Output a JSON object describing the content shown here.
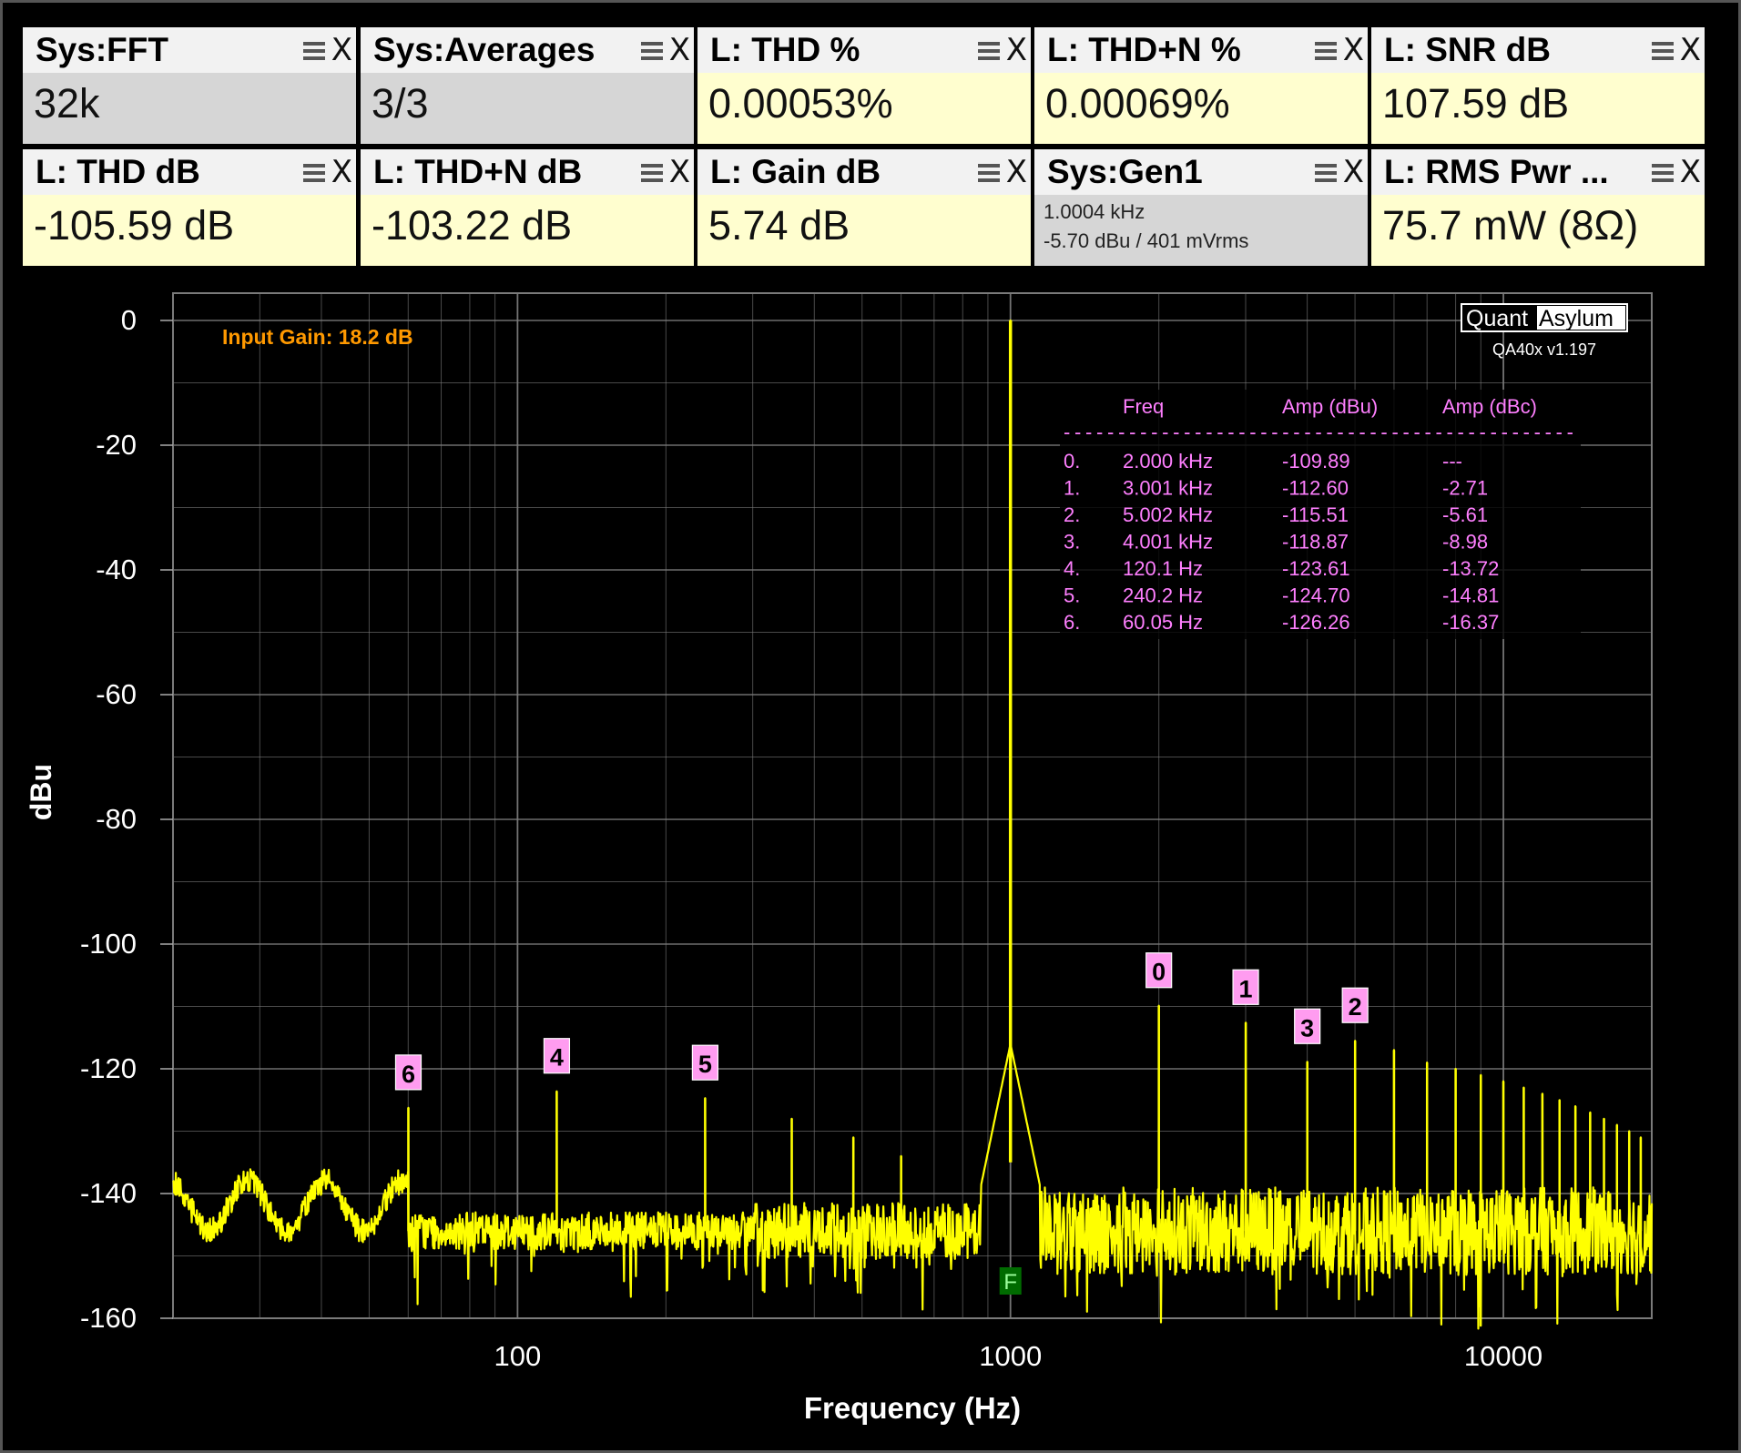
{
  "widgets": [
    {
      "title": "Sys:FFT",
      "value": "32k",
      "bg": "gray"
    },
    {
      "title": "Sys:Averages",
      "value": "3/3",
      "bg": "gray"
    },
    {
      "title": "L: THD %",
      "value": "0.00053%",
      "bg": "yellow"
    },
    {
      "title": "L: THD+N %",
      "value": "0.00069%",
      "bg": "yellow"
    },
    {
      "title": "L: SNR dB",
      "value": "107.59 dB",
      "bg": "yellow"
    },
    {
      "title": "L: THD dB",
      "value": "-105.59 dB",
      "bg": "yellow"
    },
    {
      "title": "L: THD+N dB",
      "value": "-103.22 dB",
      "bg": "yellow"
    },
    {
      "title": "L: Gain dB",
      "value": "5.74 dB",
      "bg": "yellow"
    },
    {
      "title": "Sys:Gen1",
      "line1": "1.0004 kHz",
      "line2": "-5.70 dBu  / 401 mVrms",
      "bg": "gray"
    },
    {
      "title": "L: RMS Pwr ...",
      "value": "75.7 mW (8Ω)",
      "bg": "yellow"
    }
  ],
  "icons": {
    "menu": "hamburger-menu-icon",
    "close": "close-x-icon"
  },
  "colors": {
    "trace": "#ffff00",
    "table": "#ff7fff",
    "gain": "#ff9900",
    "grid": "#7a7a7a",
    "marker_bg": "#ff9cf0",
    "fund_marker": "#006b00"
  },
  "plot": {
    "input_gain": "Input  Gain:  18.2  dB",
    "logo_left": "Quant",
    "logo_right": "Asylum",
    "version": "QA40x v1.197",
    "fundamental_marker": "F"
  },
  "harmonic_table": {
    "headers": [
      "Freq",
      "Amp (dBu)",
      "Amp (dBc)"
    ],
    "divider": "-----------------------------------------------",
    "rows": [
      {
        "idx": "0.",
        "freq": "2.000 kHz",
        "dbu": "-109.89",
        "dbc": "---"
      },
      {
        "idx": "1.",
        "freq": "3.001 kHz",
        "dbu": "-112.60",
        "dbc": "-2.71"
      },
      {
        "idx": "2.",
        "freq": "5.002 kHz",
        "dbu": "-115.51",
        "dbc": "-5.61"
      },
      {
        "idx": "3.",
        "freq": "4.001 kHz",
        "dbu": "-118.87",
        "dbc": "-8.98"
      },
      {
        "idx": "4.",
        "freq": "120.1 Hz",
        "dbu": "-123.61",
        "dbc": "-13.72"
      },
      {
        "idx": "5.",
        "freq": "240.2 Hz",
        "dbu": "-124.70",
        "dbc": "-14.81"
      },
      {
        "idx": "6.",
        "freq": "60.05 Hz",
        "dbu": "-126.26",
        "dbc": "-16.37"
      }
    ]
  },
  "chart_data": {
    "type": "line",
    "xlabel": "Frequency (Hz)",
    "ylabel": "dBu",
    "xscale": "log",
    "xlim": [
      20,
      20000
    ],
    "ylim": [
      -160,
      0
    ],
    "xticks": [
      100,
      1000,
      10000
    ],
    "xtick_labels": [
      "100",
      "1000",
      "10000"
    ],
    "yticks": [
      0,
      -20,
      -40,
      -60,
      -80,
      -100,
      -120,
      -140,
      -160
    ],
    "ytick_labels": [
      "0",
      "-20",
      "-40",
      "-60",
      "-80",
      "-100",
      "-120",
      "-140",
      "-160"
    ],
    "grid": true,
    "noise_floor_dbu": -146,
    "fundamental": {
      "freq": 1000,
      "dbu": 0
    },
    "harmonic_markers": [
      {
        "label": "0",
        "freq": 2000,
        "dbu": -109.89
      },
      {
        "label": "1",
        "freq": 3001,
        "dbu": -112.6
      },
      {
        "label": "2",
        "freq": 5002,
        "dbu": -115.51
      },
      {
        "label": "3",
        "freq": 4001,
        "dbu": -118.87
      },
      {
        "label": "4",
        "freq": 120.1,
        "dbu": -123.61
      },
      {
        "label": "5",
        "freq": 240.2,
        "dbu": -124.7
      },
      {
        "label": "6",
        "freq": 60.05,
        "dbu": -126.26
      }
    ],
    "other_spurs": [
      {
        "freq": 360,
        "dbu": -128
      },
      {
        "freq": 480,
        "dbu": -131
      },
      {
        "freq": 600,
        "dbu": -134
      },
      {
        "freq": 6000,
        "dbu": -117
      },
      {
        "freq": 7000,
        "dbu": -119
      },
      {
        "freq": 8000,
        "dbu": -120
      },
      {
        "freq": 9000,
        "dbu": -121
      },
      {
        "freq": 10000,
        "dbu": -122
      },
      {
        "freq": 11000,
        "dbu": -123
      },
      {
        "freq": 12000,
        "dbu": -124
      },
      {
        "freq": 13000,
        "dbu": -125
      },
      {
        "freq": 14000,
        "dbu": -126
      },
      {
        "freq": 15000,
        "dbu": -127
      },
      {
        "freq": 16000,
        "dbu": -128
      },
      {
        "freq": 17000,
        "dbu": -129
      },
      {
        "freq": 18000,
        "dbu": -130
      },
      {
        "freq": 19000,
        "dbu": -131
      }
    ]
  }
}
